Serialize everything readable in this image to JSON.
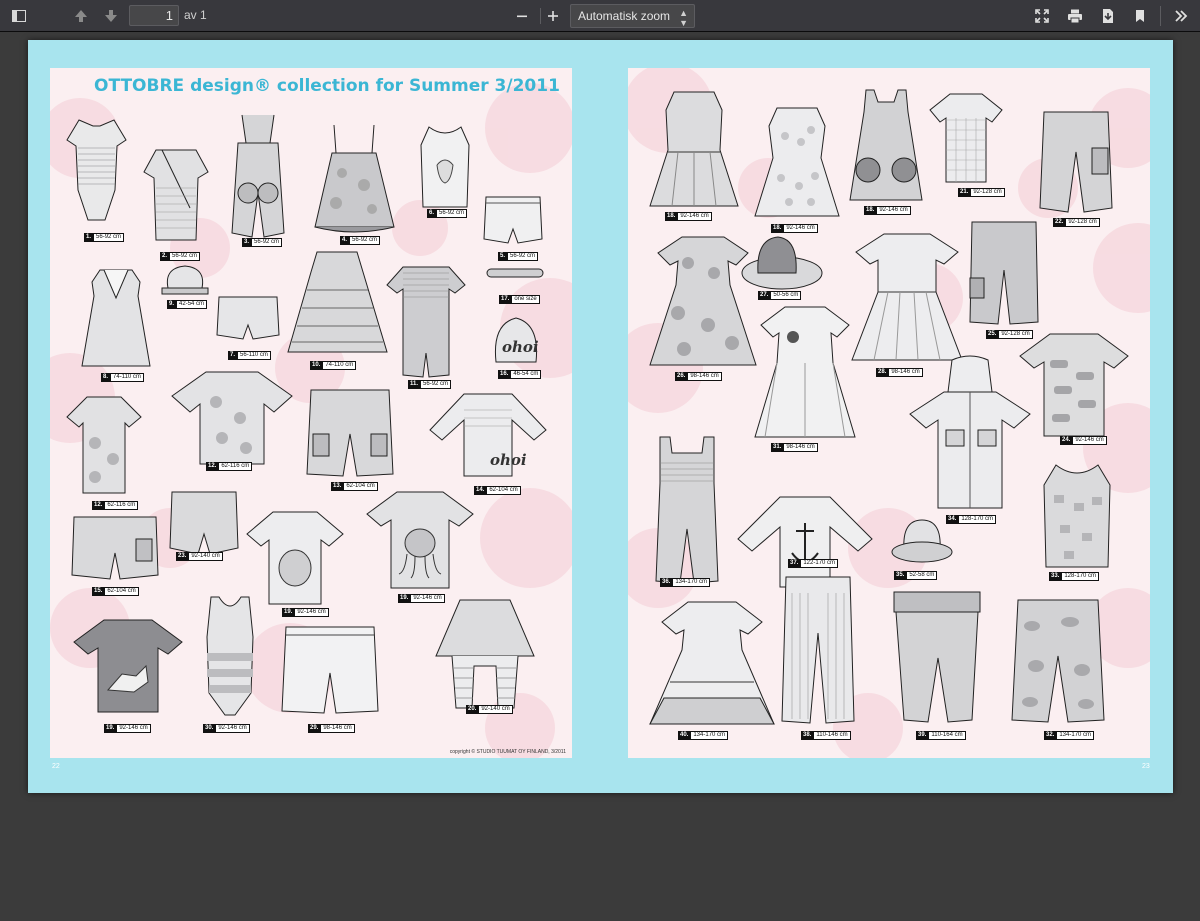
{
  "toolbar": {
    "page_number": "1",
    "page_count": "av 1",
    "zoom": "Automatisk zoom",
    "icons": [
      "sidebar-toggle-icon",
      "previous-page-icon",
      "next-page-icon",
      "zoom-out-icon",
      "zoom-in-icon",
      "presentation-mode-icon",
      "print-icon",
      "download-icon",
      "bookmark-icon",
      "tools-icon"
    ]
  },
  "colors": {
    "page_border": "#a8e4ee",
    "title": "#3bb6d4",
    "toolbar": "#38383d",
    "viewer_bg": "#3b3b3b"
  },
  "left_page": {
    "title": "OTTOBRE design® collection for Summer 3/2011",
    "copyright": "copyright © STUDIO TUUMAT OY FINLAND, 3/2011",
    "folio": "22",
    "items": [
      {
        "num": "1.",
        "size": "56-92 cm"
      },
      {
        "num": "2.",
        "size": "56-92 cm"
      },
      {
        "num": "3.",
        "size": "56-92 cm"
      },
      {
        "num": "4.",
        "size": "56-92 cm"
      },
      {
        "num": "6.",
        "size": "56-92 cm"
      },
      {
        "num": "5.",
        "size": "56-92 cm"
      },
      {
        "num": "9.",
        "size": "42-54 cm"
      },
      {
        "num": "17.",
        "size": "one size"
      },
      {
        "num": "7.",
        "size": "56-110 cm"
      },
      {
        "num": "10.",
        "size": "74-110 cm"
      },
      {
        "num": "8.",
        "size": "74-110 cm"
      },
      {
        "num": "11.",
        "size": "56-92 cm"
      },
      {
        "num": "16.",
        "size": "46-54 cm"
      },
      {
        "num": "12.",
        "size": "62-116 cm"
      },
      {
        "num": "13.",
        "size": "62-104 cm"
      },
      {
        "num": "14.",
        "size": "62-104 cm"
      },
      {
        "num": "12.",
        "size": "62-116 cm"
      },
      {
        "num": "23.",
        "size": "92-140 cm"
      },
      {
        "num": "15.",
        "size": "62-104 cm"
      },
      {
        "num": "19.",
        "size": "92-146 cm"
      },
      {
        "num": "19.",
        "size": "92-146 cm"
      },
      {
        "num": "20.",
        "size": "92-140 cm"
      },
      {
        "num": "19.",
        "size": "92-146 cm"
      },
      {
        "num": "30.",
        "size": "92-146 cm"
      },
      {
        "num": "29.",
        "size": "98-146 cm"
      }
    ],
    "prints": [
      "ohoi",
      "ohoi"
    ]
  },
  "right_page": {
    "folio": "23",
    "items": [
      {
        "num": "18.",
        "size": "92-146 cm"
      },
      {
        "num": "18.",
        "size": "92-146 cm"
      },
      {
        "num": "18.",
        "size": "92-146 cm"
      },
      {
        "num": "21.",
        "size": "92-128 cm"
      },
      {
        "num": "22.",
        "size": "92-128 cm"
      },
      {
        "num": "27.",
        "size": "50-56 cm"
      },
      {
        "num": "26.",
        "size": "98-146 cm"
      },
      {
        "num": "28.",
        "size": "98-146 cm"
      },
      {
        "num": "25.",
        "size": "92-128 cm"
      },
      {
        "num": "31.",
        "size": "98-146 cm"
      },
      {
        "num": "24.",
        "size": "92-146 cm"
      },
      {
        "num": "34.",
        "size": "128-170 cm"
      },
      {
        "num": "36.",
        "size": "134-170 cm"
      },
      {
        "num": "37.",
        "size": "122-170 cm"
      },
      {
        "num": "35.",
        "size": "52-58 cm"
      },
      {
        "num": "33.",
        "size": "128-170 cm"
      },
      {
        "num": "40.",
        "size": "134-170 cm"
      },
      {
        "num": "38.",
        "size": "110-146 cm"
      },
      {
        "num": "39.",
        "size": "110-164 cm"
      },
      {
        "num": "32.",
        "size": "134-170 cm"
      }
    ]
  }
}
